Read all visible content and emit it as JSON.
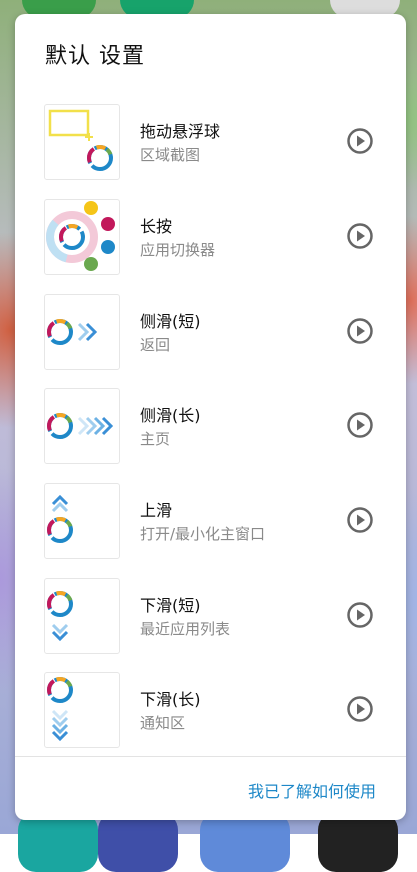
{
  "dialog": {
    "title": "默认 设置",
    "confirm_label": "我已了解如何使用",
    "gestures": [
      {
        "title": "拖动悬浮球",
        "subtitle": "区域截图"
      },
      {
        "title": "长按",
        "subtitle": "应用切换器"
      },
      {
        "title": "侧滑(短)",
        "subtitle": "返回"
      },
      {
        "title": "侧滑(长)",
        "subtitle": "主页"
      },
      {
        "title": "上滑",
        "subtitle": "打开/最小化主窗口"
      },
      {
        "title": "下滑(短)",
        "subtitle": "最近应用列表"
      },
      {
        "title": "下滑(长)",
        "subtitle": "通知区"
      }
    ]
  },
  "icons": {
    "play": "play-circle-icon",
    "ball": "floating-ball-icon"
  },
  "colors": {
    "accent": "#1e88c8",
    "ring_red": "#c2185b",
    "ring_blue": "#1e88c8",
    "ring_orange": "#f5a623",
    "ring_green": "#6aa84f",
    "arrow": "#3a8fd6",
    "crop_box": "#f2e04a"
  }
}
